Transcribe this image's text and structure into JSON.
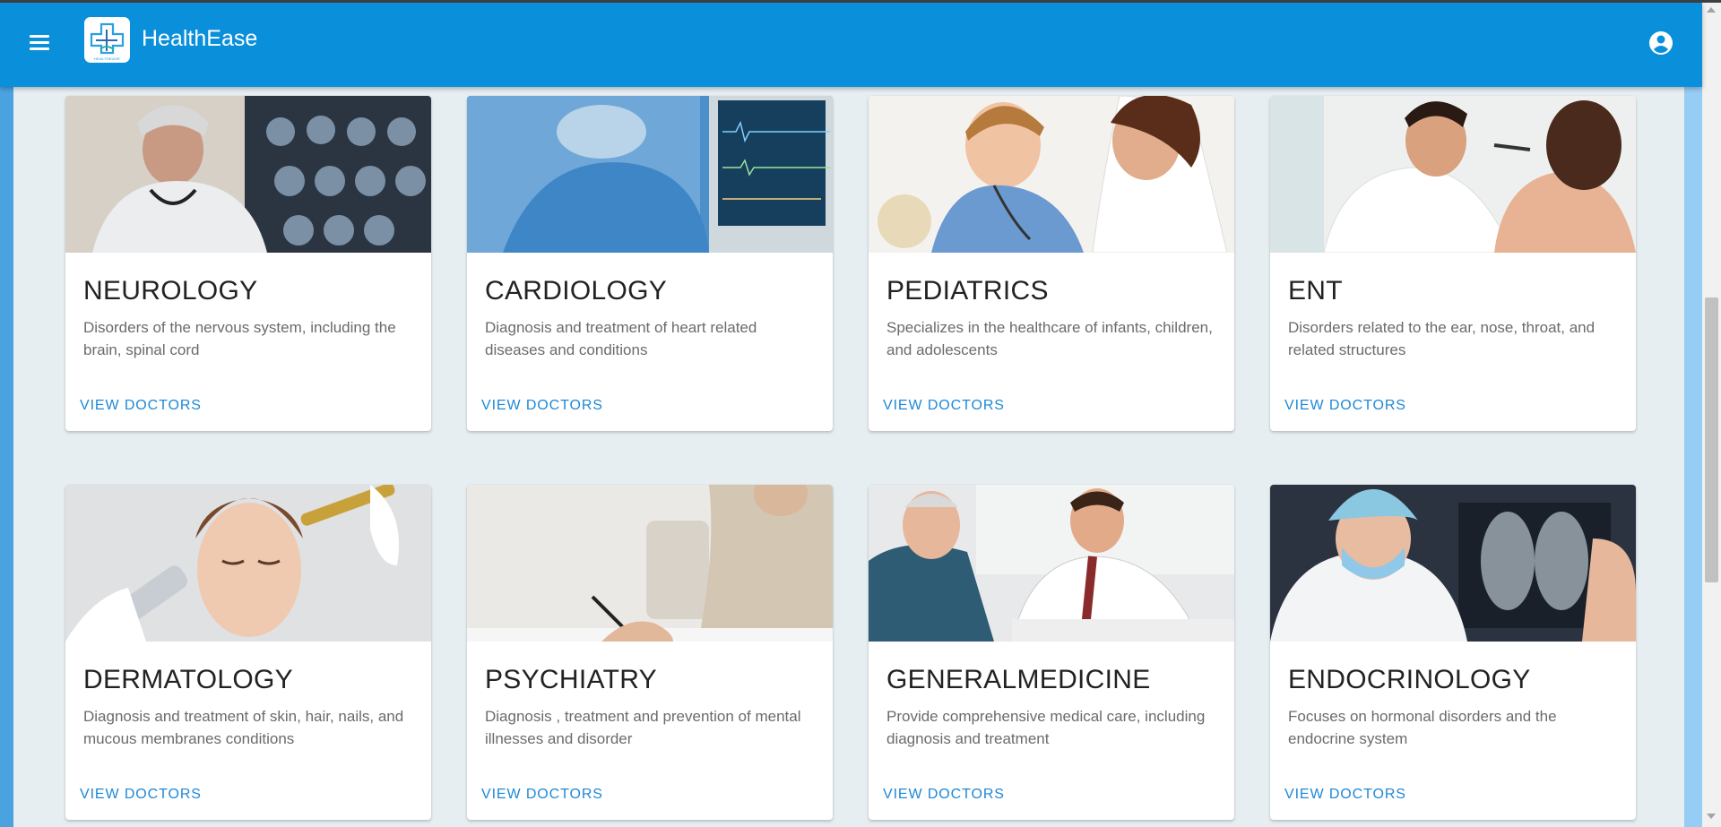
{
  "appbar": {
    "title": "HealthEase",
    "logo_text": "HEALTHEASE",
    "menu_icon": "hamburger-menu-icon",
    "account_icon": "account-circle-icon",
    "color": "#0a8fdb"
  },
  "cards": [
    {
      "title": "NEUROLOGY",
      "description": "Disorders of the nervous system, including the brain, spinal cord",
      "action": "VIEW DOCTORS"
    },
    {
      "title": "CARDIOLOGY",
      "description": "Diagnosis and treatment of heart related diseases and conditions",
      "action": "VIEW DOCTORS"
    },
    {
      "title": "PEDIATRICS",
      "description": "Specializes in the healthcare of infants, children, and adolescents",
      "action": "VIEW DOCTORS"
    },
    {
      "title": "ENT",
      "description": "Disorders related to the ear, nose, throat, and related structures",
      "action": "VIEW DOCTORS"
    },
    {
      "title": "DERMATOLOGY",
      "description": "Diagnosis and treatment of skin, hair, nails, and mucous membranes conditions",
      "action": "VIEW DOCTORS"
    },
    {
      "title": "PSYCHIATRY",
      "description": "Diagnosis , treatment and prevention of mental illnesses and disorder",
      "action": "VIEW DOCTORS"
    },
    {
      "title": "GENERALMEDICINE",
      "description": "Provide comprehensive medical care, including diagnosis and treatment",
      "action": "VIEW DOCTORS"
    },
    {
      "title": "ENDOCRINOLOGY",
      "description": "Focuses on hormonal disorders and the endocrine system",
      "action": "VIEW DOCTORS"
    }
  ]
}
